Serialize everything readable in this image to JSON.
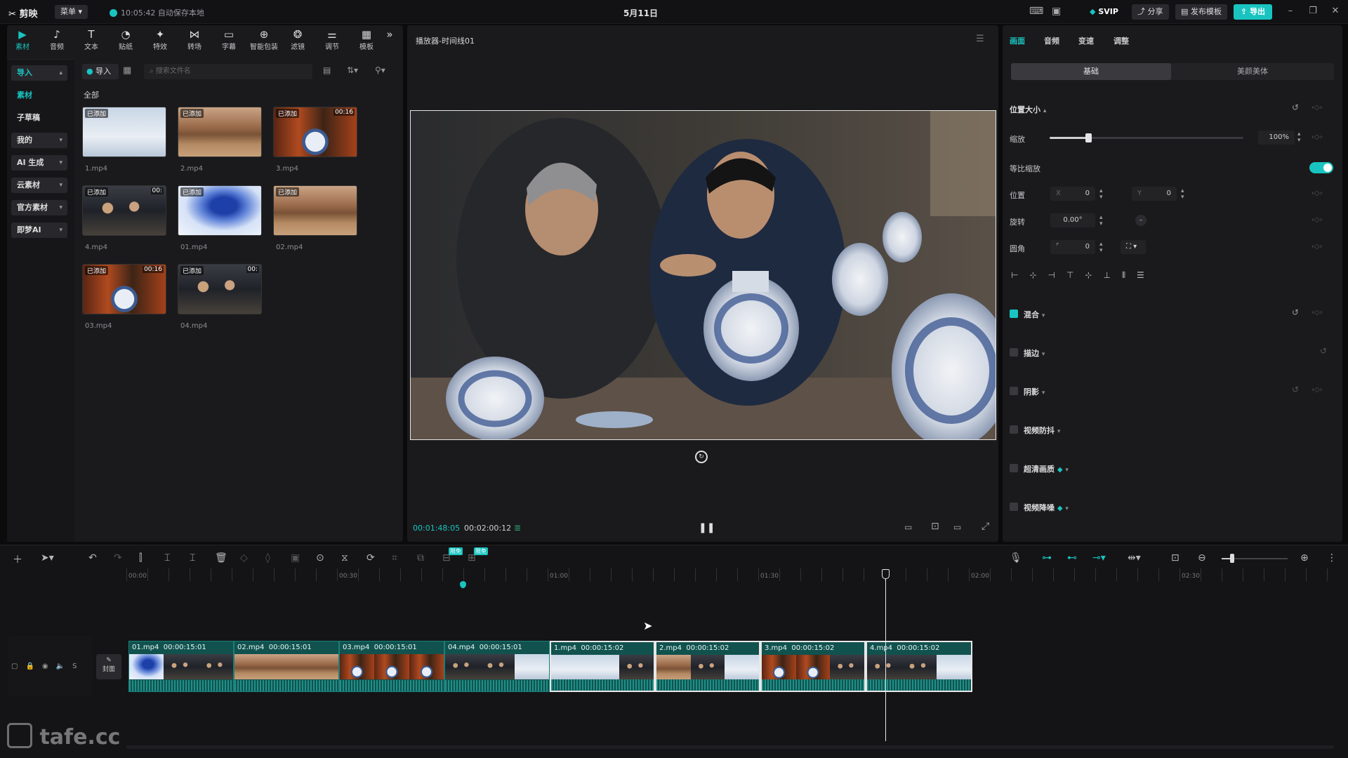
{
  "titlebar": {
    "app_name": "剪映",
    "menu_label": "菜单",
    "save_status": "10:05:42 自动保存本地",
    "date": "5月11日",
    "svip_label": "SVIP",
    "share_label": "分享",
    "publish_template_label": "发布模板",
    "export_label": "导出"
  },
  "toolbar": {
    "items": [
      {
        "label": "素材",
        "icon": "media-icon"
      },
      {
        "label": "音频",
        "icon": "audio-icon"
      },
      {
        "label": "文本",
        "icon": "text-icon"
      },
      {
        "label": "贴纸",
        "icon": "sticker-icon"
      },
      {
        "label": "特效",
        "icon": "effects-icon"
      },
      {
        "label": "转场",
        "icon": "transition-icon"
      },
      {
        "label": "字幕",
        "icon": "subtitle-icon"
      },
      {
        "label": "智能包装",
        "icon": "smart-pack-icon"
      },
      {
        "label": "滤镜",
        "icon": "filter-icon"
      },
      {
        "label": "调节",
        "icon": "adjust-icon"
      },
      {
        "label": "模板",
        "icon": "template-icon"
      }
    ]
  },
  "sidebar": {
    "items": [
      {
        "label": "导入"
      },
      {
        "label": "素材"
      },
      {
        "label": "子草稿"
      },
      {
        "label": "我的"
      },
      {
        "label": "AI 生成"
      },
      {
        "label": "云素材"
      },
      {
        "label": "官方素材"
      },
      {
        "label": "即梦AI"
      }
    ]
  },
  "media": {
    "import_label": "导入",
    "search_placeholder": "搜索文件名",
    "section_title": "全部",
    "added_tag": "已添加",
    "files": [
      {
        "name": "1.mp4"
      },
      {
        "name": "2.mp4"
      },
      {
        "name": "3.mp4",
        "duration": "00:16"
      },
      {
        "name": "4.mp4",
        "duration": "00:"
      },
      {
        "name": "01.mp4"
      },
      {
        "name": "02.mp4"
      },
      {
        "name": "03.mp4",
        "duration": "00:16"
      },
      {
        "name": "04.mp4",
        "duration": "00:"
      }
    ]
  },
  "player": {
    "title": "播放器-时间线01",
    "current_time": "00:01:48:05",
    "total_time": "00:02:00:12"
  },
  "properties": {
    "tabs": [
      "画面",
      "音频",
      "变速",
      "调整"
    ],
    "subtabs": [
      "基础",
      "美颜美体"
    ],
    "position_size_label": "位置大小",
    "scale_label": "缩放",
    "scale_value": "100%",
    "scale_fraction": 0.2,
    "uniform_scale_label": "等比缩放",
    "position_label": "位置",
    "x_label": "X",
    "x_value": "0",
    "y_label": "Y",
    "y_value": "0",
    "rotation_label": "旋转",
    "rotation_value": "0.00°",
    "corner_label": "圆角",
    "corner_value": "0",
    "sections": [
      {
        "label": "混合",
        "checked": true
      },
      {
        "label": "描边",
        "checked": false
      },
      {
        "label": "阴影",
        "checked": false
      },
      {
        "label": "视频防抖",
        "checked": false
      },
      {
        "label": "超清画质",
        "checked": false
      },
      {
        "label": "视频降噪",
        "checked": false
      }
    ]
  },
  "timeline": {
    "free_badge_1": "限免",
    "free_badge_2": "限免",
    "ruler": [
      "00:00",
      "00:30",
      "01:00",
      "01:30",
      "02:00",
      "02:30"
    ],
    "cover_label": "封面",
    "clips": [
      {
        "name": "01.mp4",
        "duration": "00:00:15:01"
      },
      {
        "name": "02.mp4",
        "duration": "00:00:15:01"
      },
      {
        "name": "03.mp4",
        "duration": "00:00:15:01"
      },
      {
        "name": "04.mp4",
        "duration": "00:00:15:01"
      },
      {
        "name": "1.mp4",
        "duration": "00:00:15:02"
      },
      {
        "name": "2.mp4",
        "duration": "00:00:15:02"
      },
      {
        "name": "3.mp4",
        "duration": "00:00:15:02"
      },
      {
        "name": "4.mp4",
        "duration": "00:00:15:02"
      }
    ]
  },
  "watermark": "tafe.cc",
  "colors": {
    "accent": "#19c4c0",
    "clip": "#11524e",
    "background": "#0b0b0c"
  }
}
